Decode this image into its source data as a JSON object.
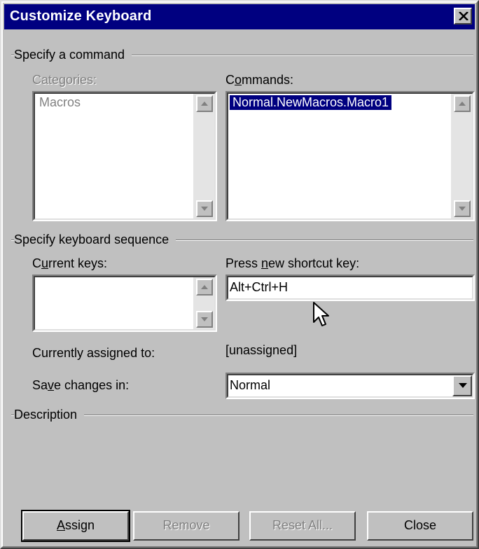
{
  "window": {
    "title": "Customize Keyboard"
  },
  "specify_command": {
    "group_label": "Specify a command",
    "categories_label": "Categories:",
    "categories": [
      "Macros"
    ],
    "commands_label": "Commands:",
    "commands": [
      "Normal.NewMacros.Macro1"
    ],
    "selected_command": "Normal.NewMacros.Macro1"
  },
  "keyboard_sequence": {
    "group_label": "Specify keyboard sequence",
    "current_keys_label": "Current keys:",
    "current_keys": [],
    "new_shortcut_label": "Press new shortcut key:",
    "new_shortcut_value": "Alt+Ctrl+H",
    "assigned_label": "Currently assigned to:",
    "assigned_value": "[unassigned]",
    "save_label": "Save changes in:",
    "save_value": "Normal"
  },
  "description": {
    "group_label": "Description",
    "text": ""
  },
  "buttons": {
    "assign": "Assign",
    "remove": "Remove",
    "reset_all": "Reset All...",
    "close": "Close"
  },
  "colors": {
    "face": "#c0c0c0",
    "titlebar": "#000080",
    "highlight": "#000080",
    "disabled_text": "#808080"
  },
  "icons": {
    "close": "close-x-icon",
    "scroll_up": "arrow-up-icon",
    "scroll_down": "arrow-down-icon",
    "dropdown": "chevron-down-icon",
    "cursor": "mouse-pointer-icon"
  }
}
